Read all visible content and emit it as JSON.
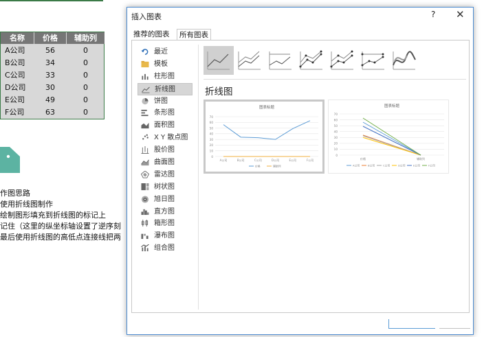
{
  "sheet": {
    "headers": [
      "名称",
      "价格",
      "辅助列"
    ],
    "rows": [
      {
        "name": "A公司",
        "price": "56",
        "aux": "0"
      },
      {
        "name": "B公司",
        "price": "34",
        "aux": "0"
      },
      {
        "name": "C公司",
        "price": "33",
        "aux": "0"
      },
      {
        "name": "D公司",
        "price": "30",
        "aux": "0"
      },
      {
        "name": "E公司",
        "price": "49",
        "aux": "0"
      },
      {
        "name": "F公司",
        "price": "63",
        "aux": "0"
      }
    ]
  },
  "notes": [
    "作图思路",
    "使用折线图制作",
    "绘制图形填充到折线图的标记上",
    "记住（这里的纵坐标轴设置了逆序刻",
    "最后使用折线图的高低点连接线把两"
  ],
  "colors": {
    "accent": "#4a8ad0",
    "tag": "#5cb3a2",
    "sheet_header": "#767676",
    "series_price": "#5b9bd5",
    "series_aux": "#f0b040"
  },
  "dialog": {
    "title": "插入图表",
    "help": "?",
    "close": "✕",
    "tabs": [
      "推荐的图表",
      "所有图表"
    ],
    "chart_types": [
      {
        "label": "最近",
        "icon": "recent-icon"
      },
      {
        "label": "模板",
        "icon": "folder-icon"
      },
      {
        "label": "柱形图",
        "icon": "column-chart-icon"
      },
      {
        "label": "折线图",
        "icon": "line-chart-icon"
      },
      {
        "label": "饼图",
        "icon": "pie-chart-icon"
      },
      {
        "label": "条形图",
        "icon": "bar-chart-icon"
      },
      {
        "label": "面积图",
        "icon": "area-chart-icon"
      },
      {
        "label": "X Y 散点图",
        "icon": "scatter-chart-icon"
      },
      {
        "label": "股价图",
        "icon": "stock-chart-icon"
      },
      {
        "label": "曲面图",
        "icon": "surface-chart-icon"
      },
      {
        "label": "雷达图",
        "icon": "radar-chart-icon"
      },
      {
        "label": "树状图",
        "icon": "treemap-chart-icon"
      },
      {
        "label": "旭日图",
        "icon": "sunburst-chart-icon"
      },
      {
        "label": "直方图",
        "icon": "histogram-chart-icon"
      },
      {
        "label": "箱形图",
        "icon": "boxplot-chart-icon"
      },
      {
        "label": "瀑布图",
        "icon": "waterfall-chart-icon"
      },
      {
        "label": "组合图",
        "icon": "combo-chart-icon"
      }
    ],
    "selected_type": "折线图",
    "section_title": "折线图",
    "subtypes": [
      "line",
      "stacked-line",
      "percent-stacked-line",
      "line-with-markers",
      "stacked-line-with-markers",
      "percent-stacked-line-with-markers",
      "3d-line"
    ]
  },
  "chart_data": [
    {
      "type": "line",
      "title": "图表标题",
      "categories": [
        "A公司",
        "B公司",
        "C公司",
        "D公司",
        "E公司",
        "F公司"
      ],
      "series": [
        {
          "name": "价格",
          "values": [
            56,
            34,
            33,
            30,
            49,
            63
          ]
        },
        {
          "name": "辅助列",
          "values": [
            0,
            0,
            0,
            0,
            0,
            0
          ]
        }
      ],
      "ylim": [
        0,
        70
      ],
      "yticks": [
        "0",
        "10",
        "20",
        "30",
        "40",
        "50",
        "60",
        "70"
      ]
    },
    {
      "type": "line",
      "title": "图表标题",
      "categories": [
        "价格",
        "辅助列"
      ],
      "series": [
        {
          "name": "A公司",
          "values": [
            56,
            0
          ]
        },
        {
          "name": "B公司",
          "values": [
            34,
            0
          ]
        },
        {
          "name": "C公司",
          "values": [
            33,
            0
          ]
        },
        {
          "name": "D公司",
          "values": [
            30,
            0
          ]
        },
        {
          "name": "E公司",
          "values": [
            49,
            0
          ]
        },
        {
          "name": "F公司",
          "values": [
            63,
            0
          ]
        }
      ],
      "ylim": [
        0,
        70
      ],
      "yticks": [
        "0",
        "10",
        "20",
        "30",
        "40",
        "50",
        "60",
        "70"
      ]
    }
  ]
}
